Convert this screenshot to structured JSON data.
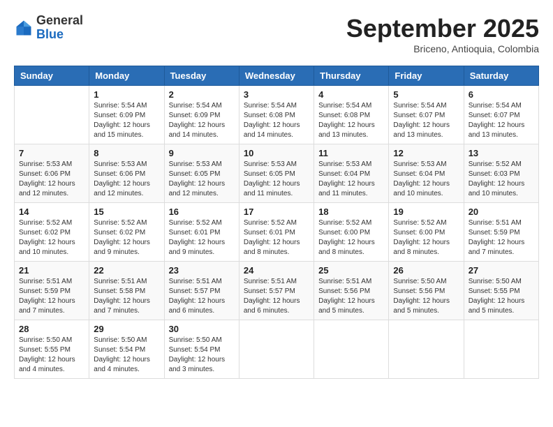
{
  "header": {
    "logo": {
      "text_general": "General",
      "text_blue": "Blue"
    },
    "title": "September 2025",
    "location": "Briceno, Antioquia, Colombia"
  },
  "days_of_week": [
    "Sunday",
    "Monday",
    "Tuesday",
    "Wednesday",
    "Thursday",
    "Friday",
    "Saturday"
  ],
  "weeks": [
    [
      {
        "day": "",
        "info": ""
      },
      {
        "day": "1",
        "info": "Sunrise: 5:54 AM\nSunset: 6:09 PM\nDaylight: 12 hours\nand 15 minutes."
      },
      {
        "day": "2",
        "info": "Sunrise: 5:54 AM\nSunset: 6:09 PM\nDaylight: 12 hours\nand 14 minutes."
      },
      {
        "day": "3",
        "info": "Sunrise: 5:54 AM\nSunset: 6:08 PM\nDaylight: 12 hours\nand 14 minutes."
      },
      {
        "day": "4",
        "info": "Sunrise: 5:54 AM\nSunset: 6:08 PM\nDaylight: 12 hours\nand 13 minutes."
      },
      {
        "day": "5",
        "info": "Sunrise: 5:54 AM\nSunset: 6:07 PM\nDaylight: 12 hours\nand 13 minutes."
      },
      {
        "day": "6",
        "info": "Sunrise: 5:54 AM\nSunset: 6:07 PM\nDaylight: 12 hours\nand 13 minutes."
      }
    ],
    [
      {
        "day": "7",
        "info": "Sunrise: 5:53 AM\nSunset: 6:06 PM\nDaylight: 12 hours\nand 12 minutes."
      },
      {
        "day": "8",
        "info": "Sunrise: 5:53 AM\nSunset: 6:06 PM\nDaylight: 12 hours\nand 12 minutes."
      },
      {
        "day": "9",
        "info": "Sunrise: 5:53 AM\nSunset: 6:05 PM\nDaylight: 12 hours\nand 12 minutes."
      },
      {
        "day": "10",
        "info": "Sunrise: 5:53 AM\nSunset: 6:05 PM\nDaylight: 12 hours\nand 11 minutes."
      },
      {
        "day": "11",
        "info": "Sunrise: 5:53 AM\nSunset: 6:04 PM\nDaylight: 12 hours\nand 11 minutes."
      },
      {
        "day": "12",
        "info": "Sunrise: 5:53 AM\nSunset: 6:04 PM\nDaylight: 12 hours\nand 10 minutes."
      },
      {
        "day": "13",
        "info": "Sunrise: 5:52 AM\nSunset: 6:03 PM\nDaylight: 12 hours\nand 10 minutes."
      }
    ],
    [
      {
        "day": "14",
        "info": "Sunrise: 5:52 AM\nSunset: 6:02 PM\nDaylight: 12 hours\nand 10 minutes."
      },
      {
        "day": "15",
        "info": "Sunrise: 5:52 AM\nSunset: 6:02 PM\nDaylight: 12 hours\nand 9 minutes."
      },
      {
        "day": "16",
        "info": "Sunrise: 5:52 AM\nSunset: 6:01 PM\nDaylight: 12 hours\nand 9 minutes."
      },
      {
        "day": "17",
        "info": "Sunrise: 5:52 AM\nSunset: 6:01 PM\nDaylight: 12 hours\nand 8 minutes."
      },
      {
        "day": "18",
        "info": "Sunrise: 5:52 AM\nSunset: 6:00 PM\nDaylight: 12 hours\nand 8 minutes."
      },
      {
        "day": "19",
        "info": "Sunrise: 5:52 AM\nSunset: 6:00 PM\nDaylight: 12 hours\nand 8 minutes."
      },
      {
        "day": "20",
        "info": "Sunrise: 5:51 AM\nSunset: 5:59 PM\nDaylight: 12 hours\nand 7 minutes."
      }
    ],
    [
      {
        "day": "21",
        "info": "Sunrise: 5:51 AM\nSunset: 5:59 PM\nDaylight: 12 hours\nand 7 minutes."
      },
      {
        "day": "22",
        "info": "Sunrise: 5:51 AM\nSunset: 5:58 PM\nDaylight: 12 hours\nand 7 minutes."
      },
      {
        "day": "23",
        "info": "Sunrise: 5:51 AM\nSunset: 5:57 PM\nDaylight: 12 hours\nand 6 minutes."
      },
      {
        "day": "24",
        "info": "Sunrise: 5:51 AM\nSunset: 5:57 PM\nDaylight: 12 hours\nand 6 minutes."
      },
      {
        "day": "25",
        "info": "Sunrise: 5:51 AM\nSunset: 5:56 PM\nDaylight: 12 hours\nand 5 minutes."
      },
      {
        "day": "26",
        "info": "Sunrise: 5:50 AM\nSunset: 5:56 PM\nDaylight: 12 hours\nand 5 minutes."
      },
      {
        "day": "27",
        "info": "Sunrise: 5:50 AM\nSunset: 5:55 PM\nDaylight: 12 hours\nand 5 minutes."
      }
    ],
    [
      {
        "day": "28",
        "info": "Sunrise: 5:50 AM\nSunset: 5:55 PM\nDaylight: 12 hours\nand 4 minutes."
      },
      {
        "day": "29",
        "info": "Sunrise: 5:50 AM\nSunset: 5:54 PM\nDaylight: 12 hours\nand 4 minutes."
      },
      {
        "day": "30",
        "info": "Sunrise: 5:50 AM\nSunset: 5:54 PM\nDaylight: 12 hours\nand 3 minutes."
      },
      {
        "day": "",
        "info": ""
      },
      {
        "day": "",
        "info": ""
      },
      {
        "day": "",
        "info": ""
      },
      {
        "day": "",
        "info": ""
      }
    ]
  ]
}
